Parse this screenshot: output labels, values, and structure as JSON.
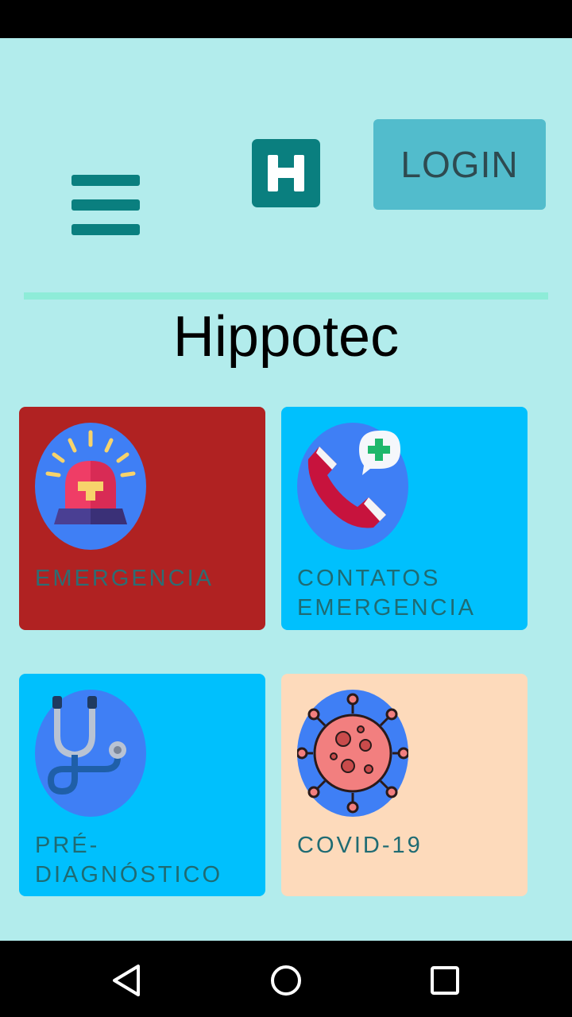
{
  "app": {
    "title": "Hippotec",
    "login_label": "LOGIN"
  },
  "icons": {
    "menu": "hamburger-menu-icon",
    "logo": "hospital-h-icon",
    "back": "triangle-back-icon",
    "home": "circle-home-icon",
    "recent": "square-recent-apps-icon"
  },
  "colors": {
    "background": "#b2ecec",
    "accent": "#0a7f7f",
    "login_button": "#52bccc",
    "divider": "#8eecd8"
  },
  "cards": [
    {
      "label": "EMERGENCIA",
      "icon": "siren-icon",
      "color": "#b02222"
    },
    {
      "label": "CONTATOS EMERGENCIA",
      "icon": "phone-plus-icon",
      "color": "#00c0fd"
    },
    {
      "label": "PRÉ-DIAGNÓSTICO",
      "icon": "stethoscope-icon",
      "color": "#00c0fd"
    },
    {
      "label": "COVID-19",
      "icon": "virus-icon",
      "color": "#fddabb"
    }
  ]
}
